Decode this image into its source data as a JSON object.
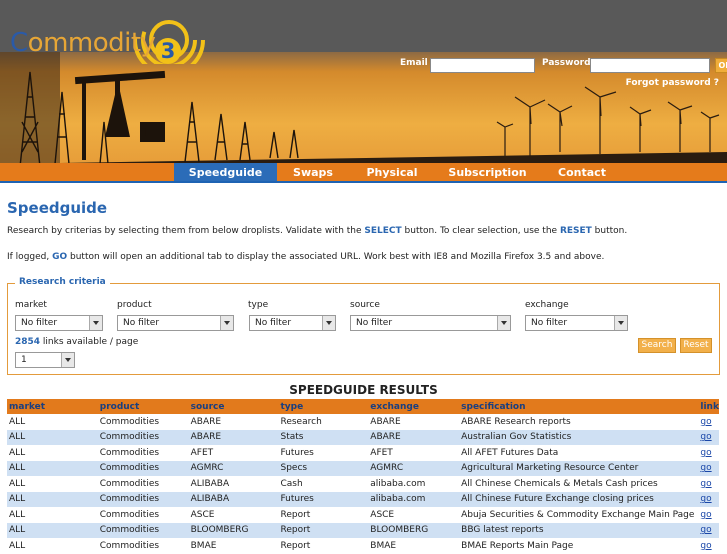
{
  "brand": {
    "logo_prefix": "C",
    "logo_rest": "ommodity",
    "logo_num": "3"
  },
  "login": {
    "email_label": "Email",
    "password_label": "Password",
    "ok_label": "OK",
    "forgot_label": "Forgot password ?"
  },
  "nav": {
    "tabs": [
      {
        "label": "Speedguide"
      },
      {
        "label": "Swaps"
      },
      {
        "label": "Physical"
      },
      {
        "label": "Subscription"
      },
      {
        "label": "Contact"
      }
    ]
  },
  "page": {
    "title": "Speedguide",
    "intro1_a": "Research by criterias by selecting them from below droplists. Validate with the ",
    "intro1_select": "SELECT",
    "intro1_b": " button. To clear selection, use the ",
    "intro1_reset": "RESET",
    "intro1_c": " button.",
    "intro2_a": "If logged, ",
    "intro2_go": "GO",
    "intro2_b": " button will open an additional tab to display the associated URL. Work best with IE8 and Mozilla Firefox 3.5 and above."
  },
  "criteria": {
    "legend": "Research criteria",
    "filters": [
      {
        "label": "market",
        "value": "No filter"
      },
      {
        "label": "product",
        "value": "No filter"
      },
      {
        "label": "type",
        "value": "No filter"
      },
      {
        "label": "source",
        "value": "No filter"
      },
      {
        "label": "exchange",
        "value": "No filter"
      }
    ],
    "links_count": "2854",
    "links_text": " links available / page",
    "page_value": "1",
    "search_label": "Search",
    "reset_label": "Reset"
  },
  "results": {
    "title": "SPEEDGUIDE RESULTS",
    "columns": [
      "market",
      "product",
      "source",
      "type",
      "exchange",
      "specification",
      "link"
    ],
    "rows": [
      [
        "ALL",
        "Commodities",
        "ABARE",
        "Research",
        "ABARE",
        "ABARE Research reports",
        "go"
      ],
      [
        "ALL",
        "Commodities",
        "ABARE",
        "Stats",
        "ABARE",
        "Australian Gov Statistics",
        "go"
      ],
      [
        "ALL",
        "Commodities",
        "AFET",
        "Futures",
        "AFET",
        "All AFET Futures Data",
        "go"
      ],
      [
        "ALL",
        "Commodities",
        "AGMRC",
        "Specs",
        "AGMRC",
        "Agricultural Marketing Resource Center",
        "go"
      ],
      [
        "ALL",
        "Commodities",
        "ALIBABA",
        "Cash",
        "alibaba.com",
        "All Chinese Chemicals & Metals Cash prices",
        "go"
      ],
      [
        "ALL",
        "Commodities",
        "ALIBABA",
        "Futures",
        "alibaba.com",
        "All Chinese Future Exchange closing prices",
        "go"
      ],
      [
        "ALL",
        "Commodities",
        "ASCE",
        "Report",
        "ASCE",
        "Abuja Securities & Commodity Exchange Main Page",
        "go"
      ],
      [
        "ALL",
        "Commodities",
        "BLOOMBERG",
        "Report",
        "BLOOMBERG",
        "BBG latest reports",
        "go"
      ],
      [
        "ALL",
        "Commodities",
        "BMAE",
        "Report",
        "BMAE",
        "BMAE Reports Main Page",
        "go"
      ]
    ]
  }
}
